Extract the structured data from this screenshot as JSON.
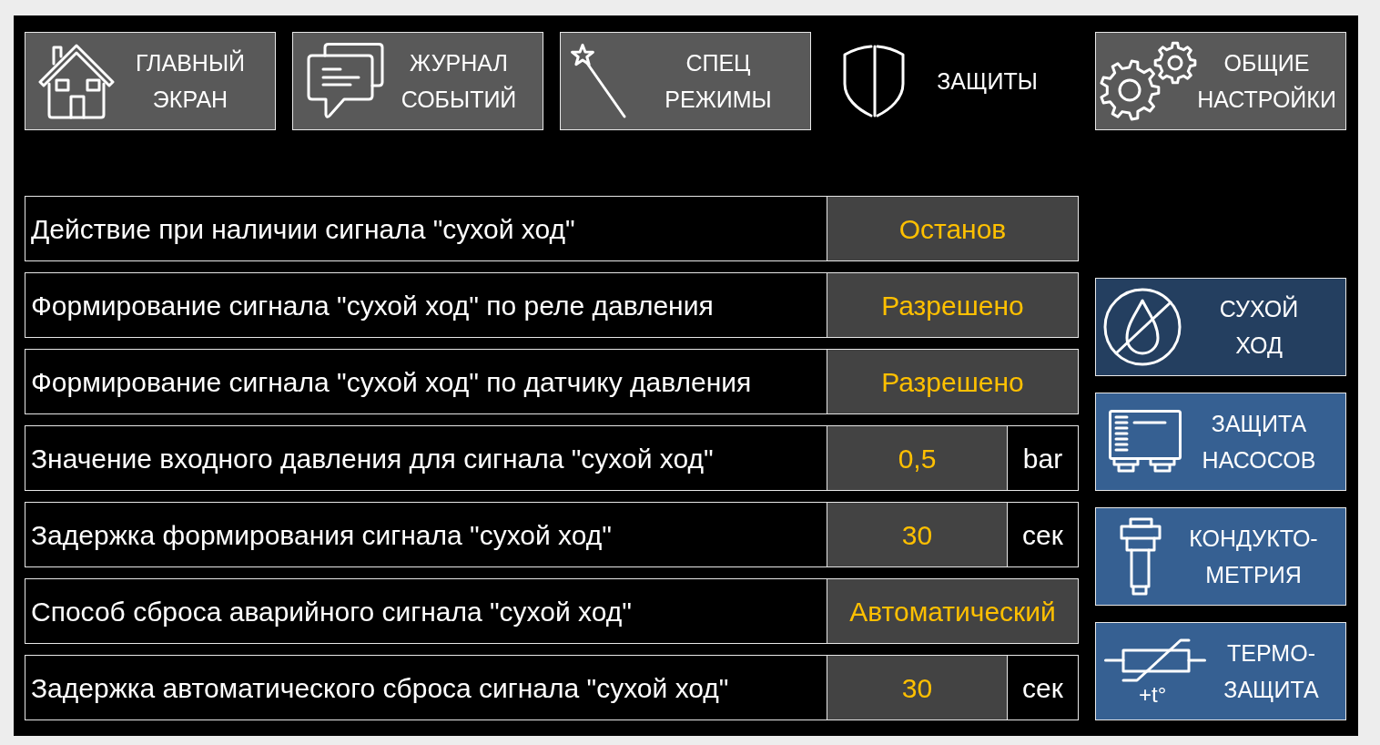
{
  "nav_tabs": [
    {
      "lines": [
        "ГЛАВНЫЙ",
        "ЭКРАН"
      ],
      "selected": false
    },
    {
      "lines": [
        "ЖУРНАЛ",
        "СОБЫТИЙ"
      ],
      "selected": false
    },
    {
      "lines": [
        "СПЕЦ",
        "РЕЖИМЫ"
      ],
      "selected": false
    },
    {
      "lines": [
        "ЗАЩИТЫ"
      ],
      "selected": true
    },
    {
      "lines": [
        "ОБЩИЕ",
        "НАСТРОЙКИ"
      ],
      "selected": false
    }
  ],
  "settings": [
    {
      "label": "Действие при наличии сигнала \"сухой ход\"",
      "value": "Останов"
    },
    {
      "label": "Формирование сигнала \"сухой ход\" по реле давления",
      "value": "Разрешено"
    },
    {
      "label": "Формирование сигнала \"сухой ход\" по датчику давления",
      "value": "Разрешено"
    },
    {
      "label": "Значение входного давления для сигнала \"сухой ход\"",
      "value": "0,5",
      "unit": "bar"
    },
    {
      "label": "Задержка формирования сигнала \"сухой ход\"",
      "value": "30",
      "unit": "сек"
    },
    {
      "label": "Способ сброса аварийного сигнала \"сухой ход\"",
      "value": "Автоматический"
    },
    {
      "label": "Задержка автоматического сброса сигнала \"сухой ход\"",
      "value": "30",
      "unit": "сек"
    }
  ],
  "side_menu": [
    {
      "lines": [
        "СУХОЙ",
        "ХОД"
      ],
      "selected": true
    },
    {
      "lines": [
        "ЗАЩИТА",
        "НАСОСОВ"
      ],
      "selected": false
    },
    {
      "lines": [
        "КОНДУКТО-",
        "МЕТРИЯ"
      ],
      "selected": false
    },
    {
      "lines": [
        "ТЕРМО-",
        "ЗАЩИТА"
      ],
      "selected": false,
      "icon_caption": "+t°"
    }
  ]
}
